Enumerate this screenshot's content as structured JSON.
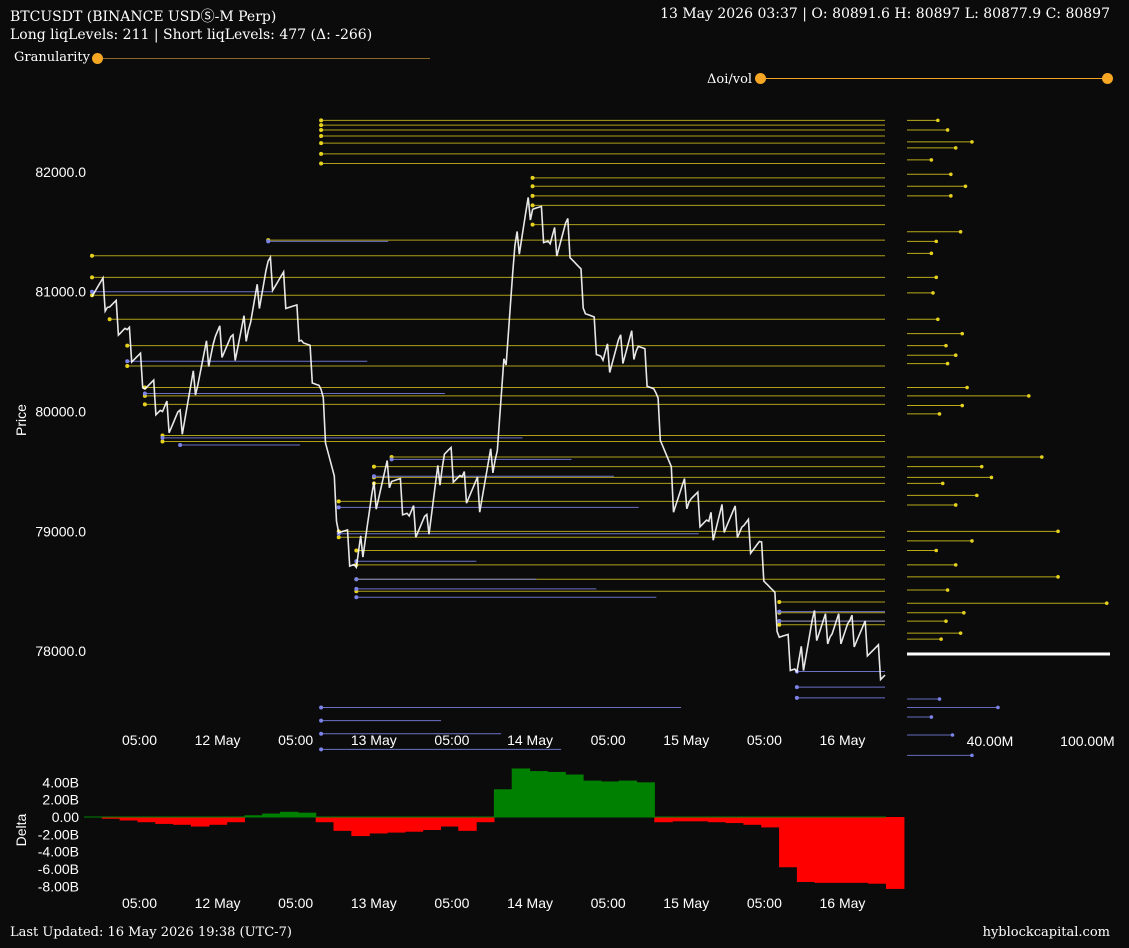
{
  "header": {
    "title": "BTCUSDT (BINANCE USDⓈ-M Perp)",
    "ohlc": "13 May 2026 03:37 | O: 80891.6 H: 80897 L: 80877.9 C: 80897",
    "liq_levels": "Long liqLevels: 211 | Short liqLevels: 477 (Δ: -266)"
  },
  "controls": {
    "granularity_label": "Granularity",
    "delta_oi_vol_label": "Δoi/vol"
  },
  "footer": {
    "last_updated": "Last Updated: 16 May 2026 19:38 (UTC-7)",
    "brand": "hyblockcapital.com"
  },
  "colors": {
    "background": "#0b0b0b",
    "price_line": "#ffffff",
    "short_liq": "#e6d21e",
    "long_liq": "#7c83e8",
    "slider": "#f5a623",
    "delta_positive": "#008000",
    "delta_negative": "#ff0000"
  },
  "chart_data": [
    {
      "type": "line",
      "ylabel": "Price",
      "ylim": [
        77300,
        82600
      ],
      "y_ticks": [
        "78000.0",
        "79000.0",
        "80000.0",
        "81000.0",
        "82000.0"
      ],
      "x_ticks": [
        "05:00",
        "12 May",
        "05:00",
        "13 May",
        "05:00",
        "14 May",
        "05:00",
        "15 May",
        "05:00",
        "16 May"
      ],
      "series": [
        {
          "values": [
            81100,
            80900,
            80600,
            80300,
            80000,
            79900,
            80300,
            80600,
            80500,
            80800,
            81200,
            81000,
            80600,
            80100,
            79100,
            78700,
            79300,
            79500,
            79100,
            79000,
            79700,
            79400,
            79300,
            79700,
            81300,
            81800,
            81400,
            81500,
            80900,
            80400,
            80500,
            80600,
            80100,
            79300,
            79300,
            79000,
            79150,
            79050,
            78800,
            78200,
            77800,
            78200,
            78200,
            78200,
            78100,
            77800
          ]
        }
      ],
      "short_liq_levels": [
        82430,
        82390,
        82350,
        82300,
        82240,
        82150,
        82070,
        81950,
        81880,
        81800,
        81720,
        81560,
        81430,
        81300,
        81120,
        80970,
        80770,
        80550,
        80380,
        80200,
        80130,
        80060,
        79800,
        79750,
        79620,
        79540,
        79450,
        79400,
        79250,
        79000,
        78950,
        78840,
        78720,
        78600,
        78500,
        78410,
        78320,
        78250,
        78220
      ],
      "long_liq_levels": [
        81420,
        81000,
        80420,
        80150,
        79780,
        79720,
        79600,
        79460,
        79200,
        78980,
        78750,
        78600,
        78520,
        78450,
        78330,
        78250,
        77830,
        77700,
        77610,
        77530,
        77420,
        77310,
        77180
      ]
    },
    {
      "type": "bar",
      "title": "Δoi/vol",
      "x_ticks": [
        "40.00M",
        "100.00M"
      ],
      "xlim": [
        0,
        125000000
      ],
      "ylim": [
        77300,
        82600
      ],
      "bars": [
        {
          "price": 82430,
          "value": 19000000,
          "side": "short"
        },
        {
          "price": 82350,
          "value": 25000000,
          "side": "short"
        },
        {
          "price": 82250,
          "value": 40000000,
          "side": "short"
        },
        {
          "price": 82200,
          "value": 30000000,
          "side": "short"
        },
        {
          "price": 82100,
          "value": 15000000,
          "side": "short"
        },
        {
          "price": 81980,
          "value": 27000000,
          "side": "short"
        },
        {
          "price": 81880,
          "value": 36000000,
          "side": "short"
        },
        {
          "price": 81800,
          "value": 27000000,
          "side": "short"
        },
        {
          "price": 81500,
          "value": 33000000,
          "side": "short"
        },
        {
          "price": 81420,
          "value": 18000000,
          "side": "short"
        },
        {
          "price": 81320,
          "value": 15000000,
          "side": "short"
        },
        {
          "price": 81120,
          "value": 18000000,
          "side": "short"
        },
        {
          "price": 80990,
          "value": 16000000,
          "side": "short"
        },
        {
          "price": 80770,
          "value": 19000000,
          "side": "short"
        },
        {
          "price": 80650,
          "value": 34000000,
          "side": "short"
        },
        {
          "price": 80550,
          "value": 24000000,
          "side": "short"
        },
        {
          "price": 80470,
          "value": 30000000,
          "side": "short"
        },
        {
          "price": 80400,
          "value": 25000000,
          "side": "short"
        },
        {
          "price": 80200,
          "value": 37000000,
          "side": "short"
        },
        {
          "price": 80130,
          "value": 75000000,
          "side": "short"
        },
        {
          "price": 80050,
          "value": 34000000,
          "side": "short"
        },
        {
          "price": 79980,
          "value": 20000000,
          "side": "short"
        },
        {
          "price": 79620,
          "value": 83000000,
          "side": "short"
        },
        {
          "price": 79540,
          "value": 46000000,
          "side": "short"
        },
        {
          "price": 79450,
          "value": 52000000,
          "side": "short"
        },
        {
          "price": 79400,
          "value": 22000000,
          "side": "short"
        },
        {
          "price": 79300,
          "value": 43000000,
          "side": "short"
        },
        {
          "price": 79220,
          "value": 30000000,
          "side": "short"
        },
        {
          "price": 79000,
          "value": 93000000,
          "side": "short"
        },
        {
          "price": 78920,
          "value": 40000000,
          "side": "short"
        },
        {
          "price": 78840,
          "value": 18000000,
          "side": "short"
        },
        {
          "price": 78720,
          "value": 30000000,
          "side": "short"
        },
        {
          "price": 78620,
          "value": 93000000,
          "side": "short"
        },
        {
          "price": 78510,
          "value": 25000000,
          "side": "short"
        },
        {
          "price": 78400,
          "value": 123000000,
          "side": "short"
        },
        {
          "price": 78320,
          "value": 35000000,
          "side": "short"
        },
        {
          "price": 78250,
          "value": 24000000,
          "side": "short"
        },
        {
          "price": 78150,
          "value": 33000000,
          "side": "short"
        },
        {
          "price": 78100,
          "value": 21000000,
          "side": "short"
        },
        {
          "price": 77600,
          "value": 20000000,
          "side": "long"
        },
        {
          "price": 77530,
          "value": 56000000,
          "side": "long"
        },
        {
          "price": 77450,
          "value": 15000000,
          "side": "long"
        },
        {
          "price": 77300,
          "value": 28000000,
          "side": "long"
        },
        {
          "price": 77130,
          "value": 40000000,
          "side": "long"
        }
      ],
      "current_price_value": 125000000
    },
    {
      "type": "area",
      "ylabel": "Delta",
      "ylim": [
        -9000000000,
        6000000000
      ],
      "y_ticks": [
        "4.00B",
        "2.00B",
        "0.00",
        "-2.00B",
        "-4.00B",
        "-6.00B",
        "-8.00B"
      ],
      "x_ticks": [
        "05:00",
        "12 May",
        "05:00",
        "13 May",
        "05:00",
        "14 May",
        "05:00",
        "15 May",
        "05:00",
        "16 May"
      ],
      "series": [
        {
          "values": [
            0,
            -0.2,
            -0.4,
            -0.6,
            -0.8,
            -0.9,
            -1.1,
            -0.9,
            -0.6,
            0.2,
            0.4,
            0.6,
            0.5,
            -0.6,
            -1.6,
            -2.2,
            -1.9,
            -1.8,
            -1.7,
            -1.5,
            -1.1,
            -1.6,
            -0.6,
            3.2,
            5.6,
            5.3,
            5.2,
            4.9,
            4.2,
            4.1,
            4.2,
            4.0,
            -0.6,
            -0.5,
            -0.5,
            -0.6,
            -0.7,
            -0.9,
            -1.2,
            -5.8,
            -7.5,
            -7.6,
            -7.6,
            -7.6,
            -7.7,
            -8.3
          ]
        }
      ]
    }
  ]
}
